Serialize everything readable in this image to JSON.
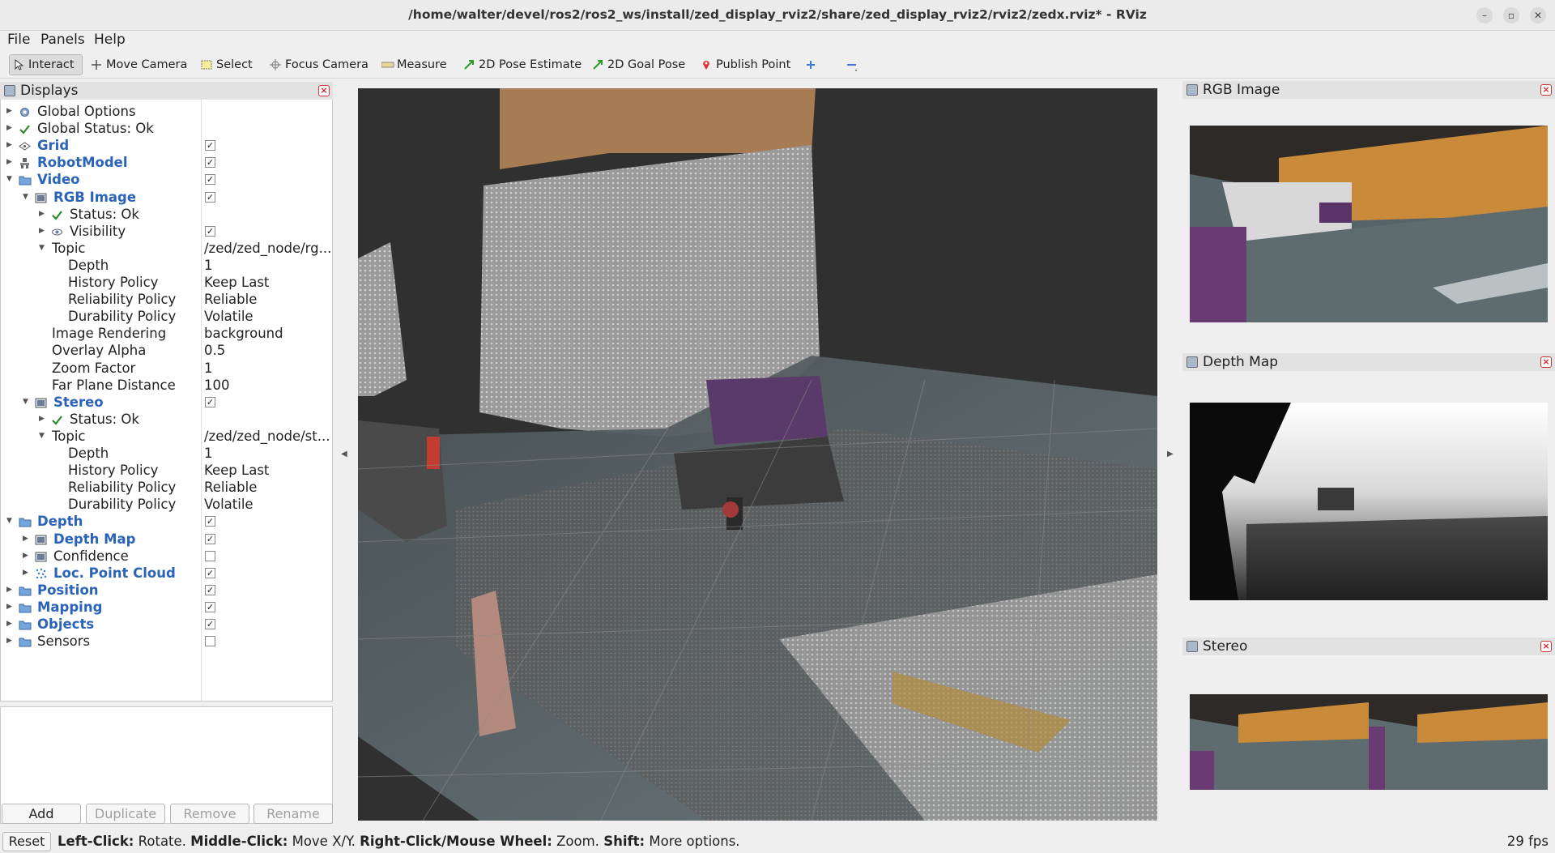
{
  "window": {
    "title": "/home/walter/devel/ros2/ros2_ws/install/zed_display_rviz2/share/zed_display_rviz2/rviz2/zedx.rviz* - RViz"
  },
  "menu": [
    "File",
    "Panels",
    "Help"
  ],
  "toolbar": {
    "interact": "Interact",
    "move_camera": "Move Camera",
    "select": "Select",
    "focus_camera": "Focus Camera",
    "measure": "Measure",
    "pose_estimate": "2D Pose Estimate",
    "goal_pose": "2D Goal Pose",
    "publish_point": "Publish Point"
  },
  "displays": {
    "title": "Displays",
    "rows": [
      {
        "label": "Global Options",
        "value": ""
      },
      {
        "label": "Global Status: Ok",
        "value": ""
      },
      {
        "label": "Grid",
        "checked": true
      },
      {
        "label": "RobotModel",
        "checked": true
      },
      {
        "label": "Video",
        "checked": true
      },
      {
        "label": "RGB Image",
        "checked": true
      },
      {
        "label": "Status: Ok",
        "value": ""
      },
      {
        "label": "Visibility",
        "checked": true
      },
      {
        "label": "Topic",
        "value": "/zed/zed_node/rg..."
      },
      {
        "label": "Depth",
        "value": "1"
      },
      {
        "label": "History Policy",
        "value": "Keep Last"
      },
      {
        "label": "Reliability Policy",
        "value": "Reliable"
      },
      {
        "label": "Durability Policy",
        "value": "Volatile"
      },
      {
        "label": "Image Rendering",
        "value": "background"
      },
      {
        "label": "Overlay Alpha",
        "value": "0.5"
      },
      {
        "label": "Zoom Factor",
        "value": "1"
      },
      {
        "label": "Far Plane Distance",
        "value": "100"
      },
      {
        "label": "Stereo",
        "checked": true
      },
      {
        "label": "Status: Ok",
        "value": ""
      },
      {
        "label": "Topic",
        "value": "/zed/zed_node/st..."
      },
      {
        "label": "Depth",
        "value": "1"
      },
      {
        "label": "History Policy",
        "value": "Keep Last"
      },
      {
        "label": "Reliability Policy",
        "value": "Reliable"
      },
      {
        "label": "Durability Policy",
        "value": "Volatile"
      },
      {
        "label": "Depth",
        "checked": true
      },
      {
        "label": "Depth Map",
        "checked": true
      },
      {
        "label": "Confidence",
        "checked": false
      },
      {
        "label": "Loc. Point Cloud",
        "checked": true
      },
      {
        "label": "Position",
        "checked": true
      },
      {
        "label": "Mapping",
        "checked": true
      },
      {
        "label": "Objects",
        "checked": true
      },
      {
        "label": "Sensors",
        "checked": false
      }
    ],
    "buttons": {
      "add": "Add",
      "duplicate": "Duplicate",
      "remove": "Remove",
      "rename": "Rename"
    }
  },
  "panels": {
    "rgb": "RGB Image",
    "depth": "Depth Map",
    "stereo": "Stereo"
  },
  "status": {
    "reset": "Reset",
    "hint_1b": "Left-Click:",
    "hint_1": " Rotate. ",
    "hint_2b": "Middle-Click:",
    "hint_2": " Move X/Y. ",
    "hint_3b": "Right-Click/Mouse Wheel:",
    "hint_3": " Zoom. ",
    "hint_4b": "Shift:",
    "hint_4": " More options.",
    "fps": "29 fps"
  },
  "colors": {
    "tree_blue": "#2a63b8",
    "viewport_bg": "#303030"
  }
}
